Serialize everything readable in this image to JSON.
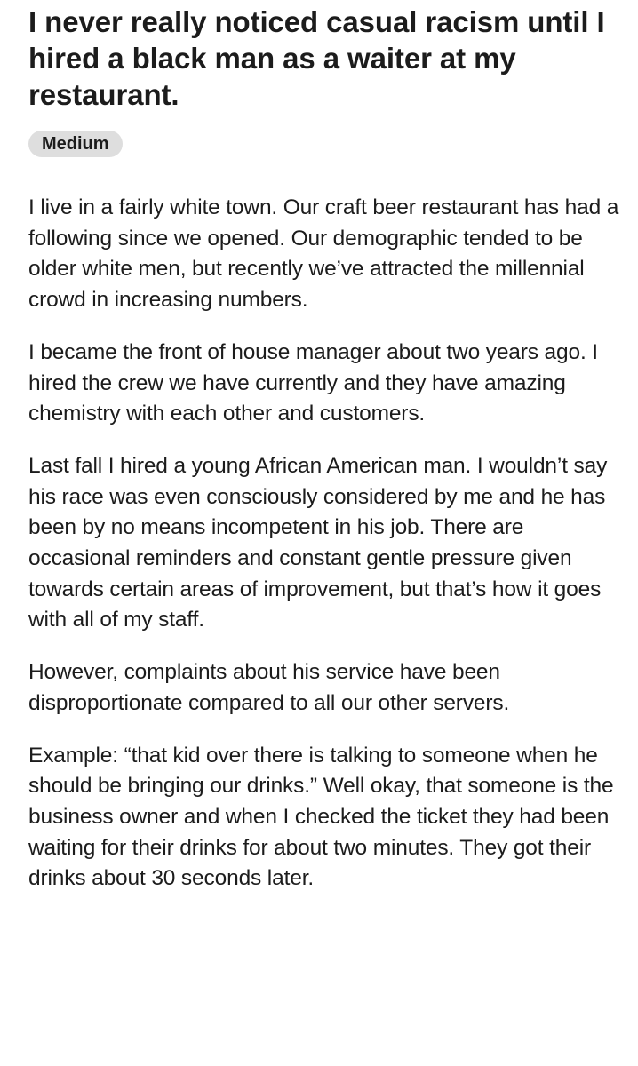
{
  "post": {
    "title": "I never really noticed casual racism until I hired a black man as a waiter at my restaurant.",
    "flair": "Medium",
    "paragraphs": [
      "I live in a fairly white town. Our craft beer restaurant has had a following since we opened. Our demographic tended to be older white men, but recently we’ve attracted the millennial crowd in increasing numbers.",
      "I became the front of house manager about two years ago. I hired the crew we have currently and they have amazing chemistry with each other and customers.",
      "Last fall I hired a young African American man. I wouldn’t say his race was even consciously considered by me and he has been by no means incompetent in his job. There are occasional reminders and constant gentle pressure given towards certain areas of improvement, but that’s how it goes with all of my staff.",
      "However, complaints about his service have been disproportionate compared to all our other servers.",
      "Example: “that kid over there is talking to someone when he should be bringing our drinks.” Well okay, that someone is the business owner and when I checked the ticket they had been waiting for their drinks for about two minutes. They got their drinks about 30 seconds later."
    ]
  },
  "colors": {
    "text": "#1c1c1c",
    "flair_background": "#dedede",
    "background": "#ffffff"
  }
}
